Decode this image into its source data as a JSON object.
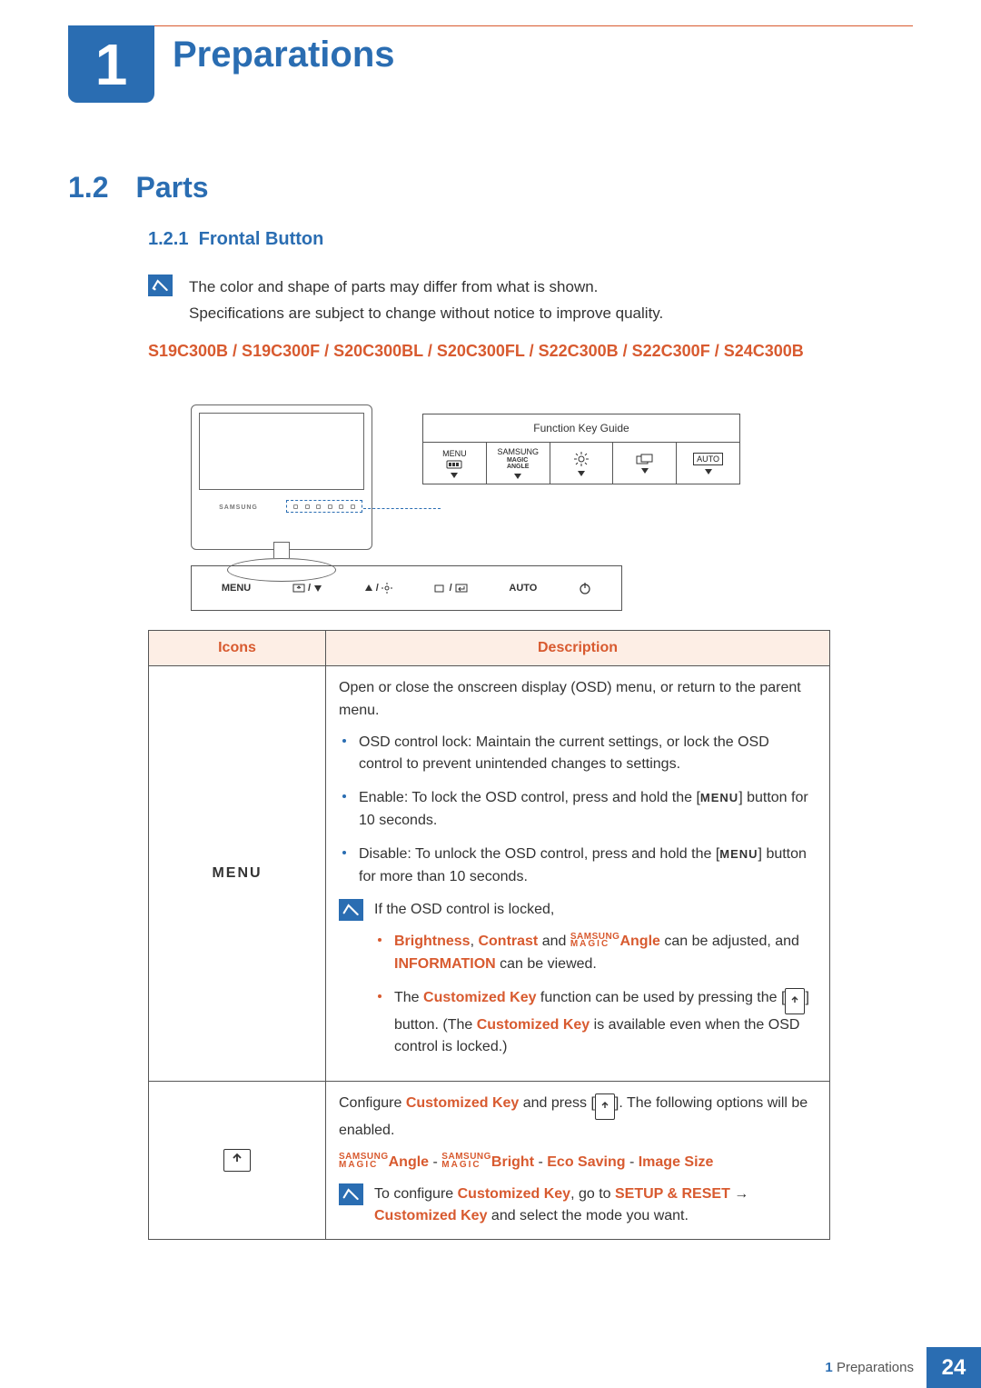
{
  "chapter": {
    "number": "1",
    "title": "Preparations"
  },
  "section": {
    "number": "1.2",
    "title": "Parts"
  },
  "subsection": {
    "number": "1.2.1",
    "title": "Frontal Button"
  },
  "note": {
    "line1": "The color and shape of parts may differ from what is shown.",
    "line2": "Specifications are subject to change without notice to improve quality."
  },
  "models": "S19C300B / S19C300F / S20C300BL / S20C300FL / S22C300B / S22C300F / S24C300B",
  "diagram": {
    "brand": "SAMSUNG",
    "keyGuideTitle": "Function Key Guide",
    "keys": {
      "menu": "MENU",
      "samsung_top": "SAMSUNG",
      "magic": "MAGIC",
      "angle": "ANGLE",
      "auto": "AUTO"
    },
    "strip": {
      "menu": "MENU",
      "auto": "AUTO"
    }
  },
  "tableHeaders": {
    "icons": "Icons",
    "description": "Description"
  },
  "row1": {
    "iconLabel": "MENU",
    "intro": "Open or close the onscreen display (OSD) menu, or return to the parent menu.",
    "b1a": "OSD control lock: Maintain the current settings, or lock the OSD control to prevent unintended changes to settings.",
    "b2a": "Enable: To lock the OSD control, press and hold the [",
    "b2b": "] button for 10 seconds.",
    "b3a": "Disable: To unlock the OSD control, press and hold the [",
    "b3b": "] button for more than 10 seconds.",
    "noteIntro": "If the OSD control is locked,",
    "sb1_brightness": "Brightness",
    "sb1_comma": ", ",
    "sb1_contrast": "Contrast",
    "sb1_and": " and ",
    "sb1_magic_top": "SAMSUNG",
    "sb1_magic_bot": "MAGIC",
    "sb1_angle": "Angle",
    "sb1_rest": " can be adjusted, and ",
    "sb1_info": "INFORMATION",
    "sb1_viewed": " can be viewed.",
    "sb2_a": "The ",
    "sb2_ck": "Customized Key",
    "sb2_b": " function can be used by pressing the [",
    "sb2_c": "] button. (The ",
    "sb2_d": " is available even when the OSD control is locked.)",
    "menuKey": "MENU"
  },
  "row2": {
    "intro_a": "Configure ",
    "intro_ck": "Customized Key",
    "intro_b": " and press [",
    "intro_c": "]. The following options will be enabled.",
    "opt_magic_top": "SAMSUNG",
    "opt_magic_bot": "MAGIC",
    "opt_angle": "Angle",
    "sep": " - ",
    "opt_bright": "Bright",
    "opt_eco": "Eco Saving",
    "opt_size": "Image Size",
    "note_a": "To configure ",
    "note_ck": "Customized Key",
    "note_b": ", go to ",
    "note_setup": "SETUP & RESET",
    "note_arrow": "  →  ",
    "note_ck2": "Customized Key",
    "note_c": " and select the mode you want."
  },
  "footer": {
    "chapterNum": "1",
    "chapterTitle": "Preparations",
    "page": "24"
  }
}
